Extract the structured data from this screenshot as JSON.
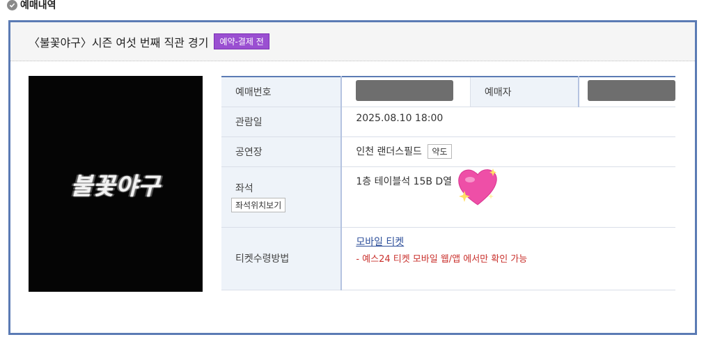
{
  "section": {
    "title": "예매내역"
  },
  "event": {
    "title": "〈불꽃야구〉시즌 여섯 번째 직관 경기",
    "status": "예약-결제 전"
  },
  "poster": {
    "logo_text": "불꽃야구"
  },
  "details": {
    "booking_number_label": "예매번호",
    "booker_label": "예매자",
    "view_date_label": "관람일",
    "view_date_value": "2025.08.10 18:00",
    "venue_label": "공연장",
    "venue_value": "인천 랜더스필드",
    "map_button": "약도",
    "seat_label": "좌석",
    "seat_button": "좌석위치보기",
    "seat_value": "1층 테이블석 15B D열",
    "ticket_method_label": "티켓수령방법",
    "ticket_method_link": "모바일 티켓",
    "ticket_method_note": "- 예스24 티켓 모바일 웹/앱 에서만 확인 가능"
  },
  "colors": {
    "frame": "#5b7bb4",
    "badge": "#9a4fd1",
    "note": "#c9302c",
    "link": "#2d4f9a"
  }
}
